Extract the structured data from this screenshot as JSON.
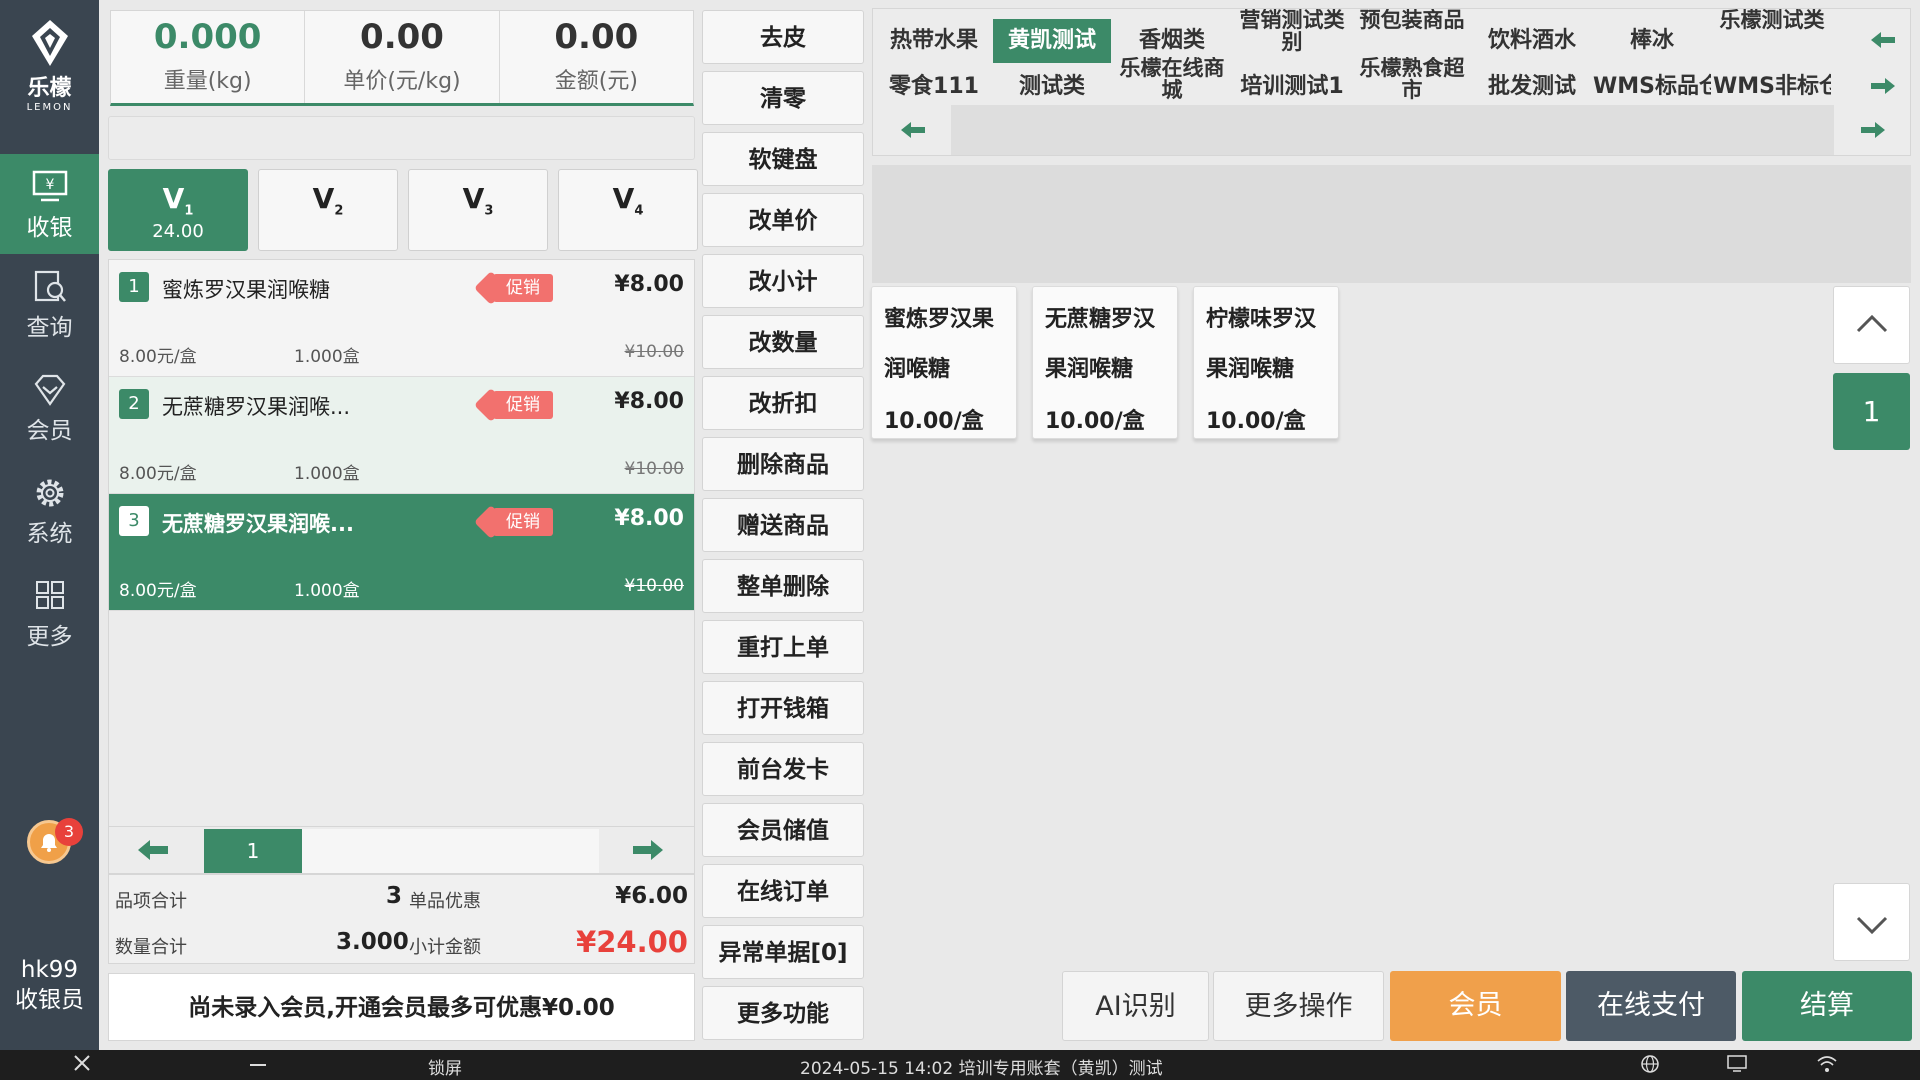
{
  "sidebar": {
    "logo_text": "乐檬",
    "logo_sub": "LEMON",
    "nav": [
      {
        "label": "收银",
        "icon": "cashier-icon"
      },
      {
        "label": "查询",
        "icon": "search-icon"
      },
      {
        "label": "会员",
        "icon": "diamond-icon"
      },
      {
        "label": "系统",
        "icon": "gear-icon"
      },
      {
        "label": "更多",
        "icon": "grid-icon"
      }
    ],
    "notification_count": "3",
    "user_id": "hk99",
    "user_role": "收银员"
  },
  "scale": {
    "weight": "0.000",
    "weight_label": "重量(kg)",
    "unit_price": "0.00",
    "unit_price_label": "单价(元/kg)",
    "amount": "0.00",
    "amount_label": "金额(元)"
  },
  "vtabs": [
    {
      "label": "V",
      "sub": "1",
      "amount": "24.00"
    },
    {
      "label": "V",
      "sub": "2",
      "amount": ""
    },
    {
      "label": "V",
      "sub": "3",
      "amount": ""
    },
    {
      "label": "V",
      "sub": "4",
      "amount": ""
    }
  ],
  "cart": [
    {
      "num": "1",
      "name": "蜜炼罗汉果润喉糖",
      "promo": "促销",
      "price": "¥8.00",
      "unit_price": "8.00元/盒",
      "qty": "1.000盒",
      "orig_price": "¥10.00"
    },
    {
      "num": "2",
      "name": "无蔗糖罗汉果润喉...",
      "promo": "促销",
      "price": "¥8.00",
      "unit_price": "8.00元/盒",
      "qty": "1.000盒",
      "orig_price": "¥10.00"
    },
    {
      "num": "3",
      "name": "无蔗糖罗汉果润喉...",
      "promo": "促销",
      "price": "¥8.00",
      "unit_price": "8.00元/盒",
      "qty": "1.000盒",
      "orig_price": "¥10.00"
    }
  ],
  "cart_page": "1",
  "totals": {
    "items_label": "品项合计",
    "items_value": "3",
    "discount_label": "单品优惠",
    "discount_value": "¥6.00",
    "qty_label": "数量合计",
    "qty_value": "3.000",
    "subtotal_label": "小计金额",
    "subtotal_value": "¥24.00"
  },
  "member_hint": "尚未录入会员,开通会员最多可优惠¥0.00",
  "functions": [
    "去皮",
    "清零",
    "软键盘",
    "改单价",
    "改小计",
    "改数量",
    "改折扣",
    "删除商品",
    "赠送商品",
    "整单删除",
    "重打上单",
    "打开钱箱",
    "前台发卡",
    "会员储值",
    "在线订单",
    "异常单据[0]",
    "更多功能"
  ],
  "categories_row1": [
    "热带水果",
    "黄凯测试",
    "香烟类",
    "营销测试类别",
    "预包装商品",
    "饮料酒水",
    "棒冰",
    "乐檬测试类"
  ],
  "categories_row2": [
    "零食111",
    "测试类",
    "乐檬在线商城",
    "培训测试1",
    "乐檬熟食超市",
    "批发测试",
    "WMS标品仓",
    "WMS非标仓"
  ],
  "products": [
    {
      "name1": "蜜炼罗汉果",
      "name2": "润喉糖",
      "price": "10.00/盒"
    },
    {
      "name1": "无蔗糖罗汉",
      "name2": "果润喉糖",
      "price": "10.00/盒"
    },
    {
      "name1": "柠檬味罗汉",
      "name2": "果润喉糖",
      "price": "10.00/盒"
    }
  ],
  "product_page": "1",
  "actions": {
    "ai": "AI识别",
    "more_ops": "更多操作",
    "member": "会员",
    "online_pay": "在线支付",
    "checkout": "结算"
  },
  "colors": {
    "accent": "#3c8a68",
    "member": "#f0a04b",
    "online": "#4d5a66",
    "price_red": "#e8413b"
  },
  "taskbar": {
    "lock": "锁屏",
    "status": "2024-05-15 14:02  培训专用账套（黄凯）测试"
  }
}
